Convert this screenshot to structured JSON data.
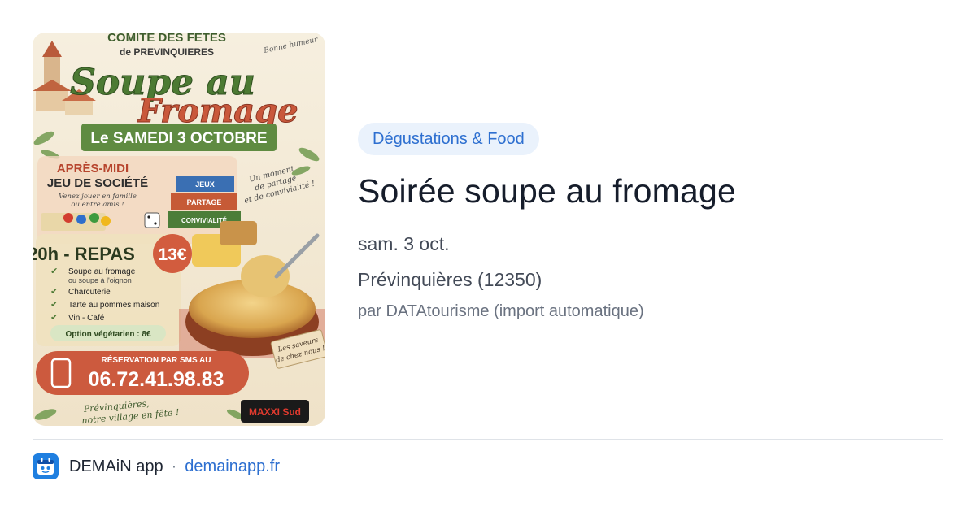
{
  "poster": {
    "organizer_line1": "COMITÉ DES FÊTES",
    "organizer_line2": "de PREVINQUIERES",
    "corner_note": "Bonne humeur",
    "headline1": "Soupe au",
    "headline2": "Fromage",
    "date_banner": "Le SAMEDI 3 OCTOBRE",
    "afternoon_title1": "APRÈS-MIDI",
    "afternoon_title2": "JEU DE SOCIÉTÉ",
    "afternoon_sub1": "Venez jouer en famille",
    "afternoon_sub2": "ou entre amis !",
    "box_labels": [
      "JEUX",
      "PARTAGE",
      "CONVIVIALITÉ"
    ],
    "side_note": [
      "Un moment",
      "de partage",
      "et de convivialité !"
    ],
    "meal_title": "20h - REPAS",
    "price": "13€",
    "menu": [
      "Soupe au fromage",
      "ou soupe à l'oignon",
      "Charcuterie",
      "Tarte au pommes maison",
      "Vin - Café"
    ],
    "veg_option": "Option végétarien : 8€",
    "flavor_note": [
      "Les saveurs",
      "de chez nous !"
    ],
    "reservation_label": "RÉSERVATION PAR SMS AU",
    "phone": "06.72.41.98.83",
    "footer_slogan1": "Prévinquières,",
    "footer_slogan2": "notre village en fête !",
    "sponsor": "MAXXI Sud"
  },
  "event": {
    "category": "Dégustations & Food",
    "title": "Soirée soupe au fromage",
    "date": "sam. 3 oct.",
    "location": "Prévinquières (12350)",
    "source": "par DATAtourisme (import automatique)"
  },
  "footer": {
    "app_name": "DEMAiN app",
    "separator": "·",
    "domain": "demainapp.fr"
  },
  "colors": {
    "accent": "#2d6fd0",
    "badge_bg": "#eaf2fc",
    "app_icon": "#1f7fe0"
  },
  "icons": {
    "app": "demain-app-icon",
    "phone": "phone-icon",
    "check": "check-icon"
  }
}
